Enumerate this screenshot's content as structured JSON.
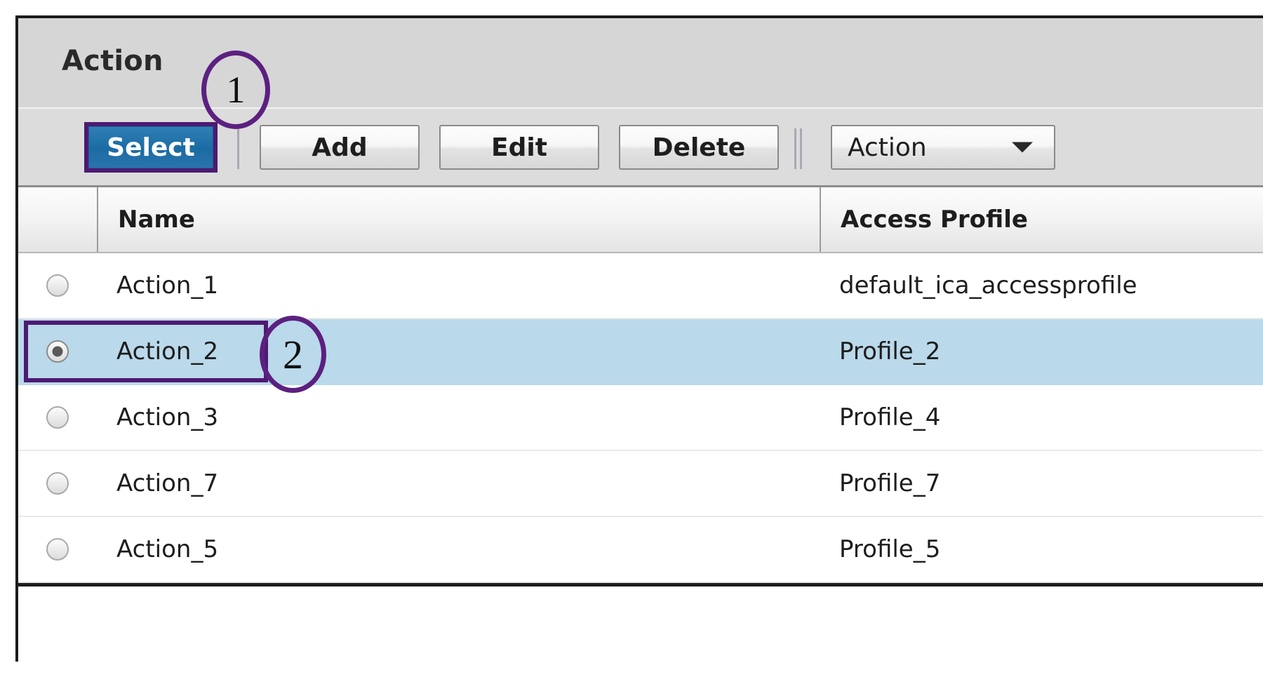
{
  "panel": {
    "title": "Action"
  },
  "toolbar": {
    "select_label": "Select",
    "add_label": "Add",
    "edit_label": "Edit",
    "delete_label": "Delete",
    "dropdown_value": "Action",
    "dropdown_icon": "chevron-down-icon"
  },
  "table": {
    "columns": [
      "",
      "Name",
      "Access Profile"
    ],
    "rows": [
      {
        "selected": false,
        "name": "Action_1",
        "access_profile": "default_ica_accessprofile"
      },
      {
        "selected": true,
        "name": "Action_2",
        "access_profile": "Profile_2"
      },
      {
        "selected": false,
        "name": "Action_3",
        "access_profile": "Profile_4"
      },
      {
        "selected": false,
        "name": "Action_7",
        "access_profile": "Profile_7"
      },
      {
        "selected": false,
        "name": "Action_5",
        "access_profile": "Profile_5"
      }
    ]
  },
  "annotations": {
    "step_one": "1",
    "step_two": "2",
    "color": "#5c2080"
  },
  "colors": {
    "primary_button": "#1d6ea6",
    "annotation_purple": "#4d1a72",
    "selected_row": "#bad9ea",
    "header_bg": "#d6d6d6",
    "toolbar_bg": "#dcdcdc"
  }
}
